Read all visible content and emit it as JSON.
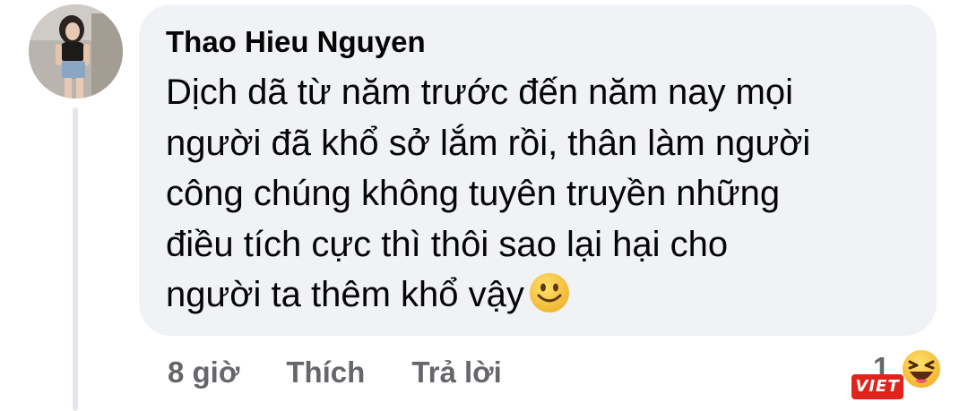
{
  "comment": {
    "author": "Thao Hieu Nguyen",
    "lines": [
      "Dịch dã từ năm trước đến năm nay mọi",
      "người đã khổ sở lắm rồi, thân làm người",
      "công chúng không tuyên truyền những",
      "điều tích cực thì thôi sao lại hại cho",
      "người ta thêm khổ vậy"
    ],
    "trailing_emoji": "slightly-smiling-face-icon"
  },
  "actions": {
    "time": "8 giờ",
    "like_label": "Thích",
    "reply_label": "Trả lời"
  },
  "reactions": {
    "count": "1",
    "icon": "haha-icon"
  },
  "watermark": {
    "text": "VIET"
  },
  "colors": {
    "bubble": "#f0f2f5",
    "text": "#050505",
    "secondary_text": "#65676b",
    "thread_line": "#e4e6eb",
    "watermark_bg": "#e0241b",
    "emoji_yellow": "#f7c948"
  }
}
